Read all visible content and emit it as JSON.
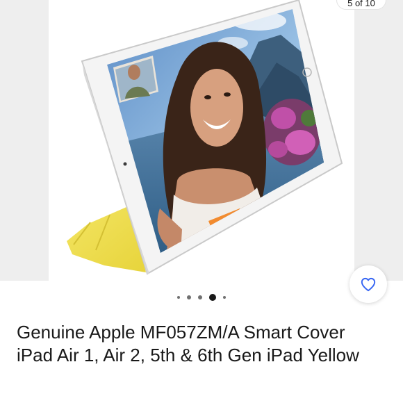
{
  "gallery": {
    "counter": "5 of 10",
    "slide_count": 5,
    "active_slide": 4
  },
  "product": {
    "title": "Genuine Apple MF057ZM/A Smart Cover iPad Air 1, Air 2, 5th & 6th Gen iPad Yellow"
  },
  "icons": {
    "favorite": "heart-outline-icon"
  },
  "colors": {
    "cover": "#efdf4e",
    "text": "#191919",
    "accent": "#3665f3"
  }
}
